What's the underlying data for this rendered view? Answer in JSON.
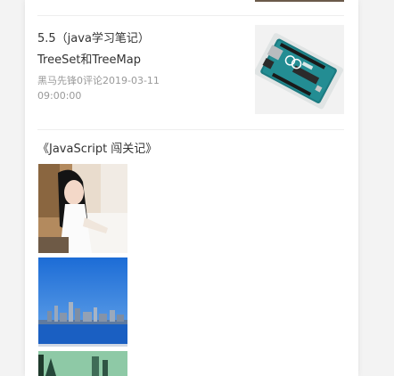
{
  "article": {
    "title_line1": "5.5（java学习笔记）",
    "title_line2": "TreeSet和TreeMap",
    "meta_line1": "黑马先锋0评论2019-03-11",
    "meta_line2": "09:00:00"
  },
  "gallery": {
    "title": "《JavaScript 闯关记》",
    "images": [
      "woman-photo",
      "city-skyline-photo",
      "green-photo"
    ]
  }
}
